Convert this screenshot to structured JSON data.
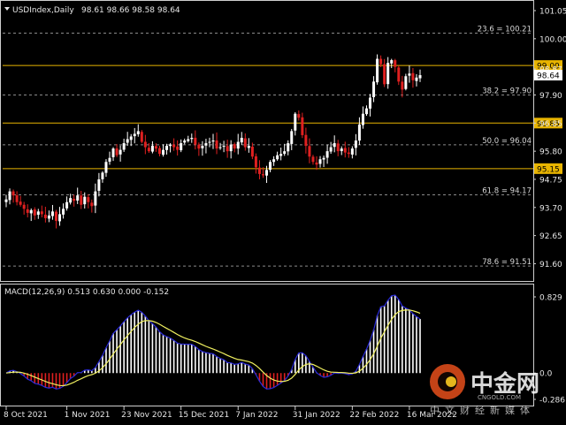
{
  "header": {
    "symbol": "USDIndex,Daily",
    "ohlc": "98.61 98.66 98.58 98.64"
  },
  "macd": {
    "label": "MACD(12,26,9) 0.513 0.630 0.000 -0.152",
    "ticks": [
      "0.829",
      "0.0",
      "-0.286"
    ]
  },
  "colors": {
    "background": "#000000",
    "bull": "#ffffff",
    "bear": "#e02020",
    "hline": "#e8b400",
    "fibline": "#8a8a8a",
    "macd_line": "#2a2ad8",
    "signal_line": "#f0f060",
    "hist_pos": "#ffffff",
    "hist_neg": "#e02020"
  },
  "watermark": {
    "brand": "中金网",
    "domain": "CNGOLD.COM",
    "tagline": "中文财经新媒体"
  },
  "chart_data": {
    "type": "line",
    "subtype": "candlestick",
    "price_axis": {
      "range": [
        91.12,
        101.05
      ],
      "ticks": [
        "101.05",
        "100.00",
        "98.87",
        "97.90",
        "96.85",
        "95.80",
        "94.75",
        "93.70",
        "92.65",
        "91.60"
      ],
      "current_price": "98.64"
    },
    "x_ticks": [
      "8 Oct 2021",
      "1 Nov 2021",
      "23 Nov 2021",
      "15 Dec 2021",
      "7 Jan 2022",
      "31 Jan 2022",
      "22 Feb 2022",
      "16 Mar 2022"
    ],
    "horizontal_levels": [
      {
        "value": 99.0,
        "label": "99.00"
      },
      {
        "value": 96.85,
        "label": "96.85"
      },
      {
        "value": 95.15,
        "label": "95.15"
      }
    ],
    "fibonacci_levels": [
      {
        "value": 100.21,
        "label": "23.6 = 100.21"
      },
      {
        "value": 97.9,
        "label": "38.2 = 97.90"
      },
      {
        "value": 96.04,
        "label": "50.0 = 96.04"
      },
      {
        "value": 94.17,
        "label": "61.8 = 94.17"
      },
      {
        "value": 91.51,
        "label": "78.6 = 91.51"
      }
    ],
    "closes": [
      94.0,
      94.3,
      94.15,
      93.9,
      93.8,
      93.65,
      93.5,
      93.6,
      93.4,
      93.55,
      93.45,
      93.3,
      93.4,
      93.55,
      93.2,
      93.45,
      93.65,
      93.9,
      94.05,
      93.95,
      94.15,
      93.8,
      94.1,
      93.9,
      93.75,
      94.3,
      94.75,
      95.0,
      95.4,
      95.55,
      95.9,
      95.65,
      95.85,
      96.1,
      96.25,
      96.35,
      96.45,
      96.55,
      96.15,
      95.95,
      95.8,
      96.0,
      95.9,
      95.7,
      95.85,
      96.0,
      96.05,
      95.95,
      95.85,
      96.1,
      96.2,
      96.25,
      96.3,
      96.05,
      95.9,
      96.0,
      96.1,
      96.15,
      96.2,
      95.9,
      95.95,
      96.0,
      95.8,
      96.05,
      95.9,
      96.15,
      96.3,
      95.95,
      96.0,
      95.6,
      95.2,
      94.95,
      94.9,
      95.1,
      95.4,
      95.5,
      95.65,
      95.7,
      95.8,
      96.1,
      96.55,
      97.2,
      97.05,
      96.4,
      96.0,
      95.6,
      95.4,
      95.3,
      95.5,
      95.55,
      95.8,
      95.95,
      96.1,
      95.8,
      95.9,
      95.75,
      95.7,
      95.9,
      96.2,
      96.8,
      97.2,
      97.4,
      97.8,
      98.4,
      99.25,
      99.05,
      98.3,
      99.1,
      99.2,
      98.95,
      98.4,
      98.1,
      98.6,
      98.7,
      98.45,
      98.55,
      98.64
    ],
    "macd_histogram_range": [
      -0.286,
      0.829
    ]
  }
}
